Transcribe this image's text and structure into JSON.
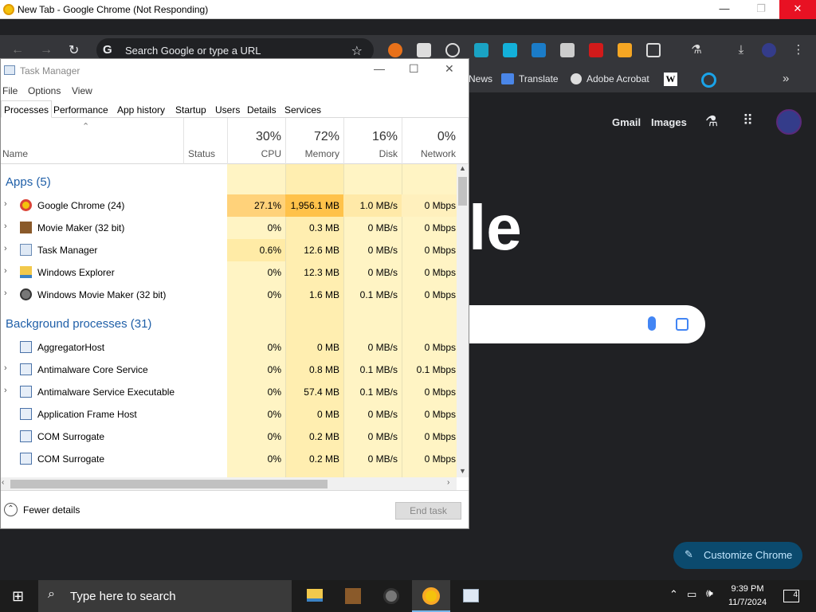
{
  "chrome": {
    "window_title": "New Tab - Google Chrome (Not Responding)",
    "omnibox_placeholder": "Search Google or type a URL",
    "bookmarks": [
      "News",
      "Translate",
      "Adobe Acrobat"
    ],
    "page_links": [
      "Gmail",
      "Images"
    ],
    "logo_fragment": "le",
    "customize_label": "Customize Chrome"
  },
  "tm": {
    "title": "Task Manager",
    "menu": [
      "File",
      "Options",
      "View"
    ],
    "tabs": [
      "Processes",
      "Performance",
      "App history",
      "Startup",
      "Users",
      "Details",
      "Services"
    ],
    "headers": {
      "name": "Name",
      "status": "Status",
      "cpu_pct": "30%",
      "cpu": "CPU",
      "mem_pct": "72%",
      "mem": "Memory",
      "disk_pct": "16%",
      "disk": "Disk",
      "net_pct": "0%",
      "net": "Network"
    },
    "groups": {
      "apps": "Apps (5)",
      "bg": "Background processes (31)"
    },
    "apps": [
      {
        "name": "Google Chrome (24)",
        "cpu": "27.1%",
        "mem": "1,956.1 MB",
        "disk": "1.0 MB/s",
        "net": "0 Mbps"
      },
      {
        "name": "Movie Maker (32 bit)",
        "cpu": "0%",
        "mem": "0.3 MB",
        "disk": "0 MB/s",
        "net": "0 Mbps"
      },
      {
        "name": "Task Manager",
        "cpu": "0.6%",
        "mem": "12.6 MB",
        "disk": "0 MB/s",
        "net": "0 Mbps"
      },
      {
        "name": "Windows Explorer",
        "cpu": "0%",
        "mem": "12.3 MB",
        "disk": "0 MB/s",
        "net": "0 Mbps"
      },
      {
        "name": "Windows Movie Maker (32 bit)",
        "cpu": "0%",
        "mem": "1.6 MB",
        "disk": "0.1 MB/s",
        "net": "0 Mbps"
      }
    ],
    "bg": [
      {
        "name": "AggregatorHost",
        "cpu": "0%",
        "mem": "0 MB",
        "disk": "0 MB/s",
        "net": "0 Mbps"
      },
      {
        "name": "Antimalware Core Service",
        "cpu": "0%",
        "mem": "0.8 MB",
        "disk": "0.1 MB/s",
        "net": "0.1 Mbps"
      },
      {
        "name": "Antimalware Service Executable",
        "cpu": "0%",
        "mem": "57.4 MB",
        "disk": "0.1 MB/s",
        "net": "0 Mbps"
      },
      {
        "name": "Application Frame Host",
        "cpu": "0%",
        "mem": "0 MB",
        "disk": "0 MB/s",
        "net": "0 Mbps"
      },
      {
        "name": "COM Surrogate",
        "cpu": "0%",
        "mem": "0.2 MB",
        "disk": "0 MB/s",
        "net": "0 Mbps"
      },
      {
        "name": "COM Surrogate",
        "cpu": "0%",
        "mem": "0.2 MB",
        "disk": "0 MB/s",
        "net": "0 Mbps"
      }
    ],
    "fewer_details": "Fewer details",
    "end_task": "End task"
  },
  "taskbar": {
    "search_placeholder": "Type here to search",
    "time": "9:39 PM",
    "date": "11/7/2024",
    "notification_count": "4"
  },
  "colors": {
    "heat_high": "#ffc76b",
    "heat_mid": "#ffe9a8",
    "heat_low": "#fff4c4",
    "accent": "#1f5fa8"
  }
}
